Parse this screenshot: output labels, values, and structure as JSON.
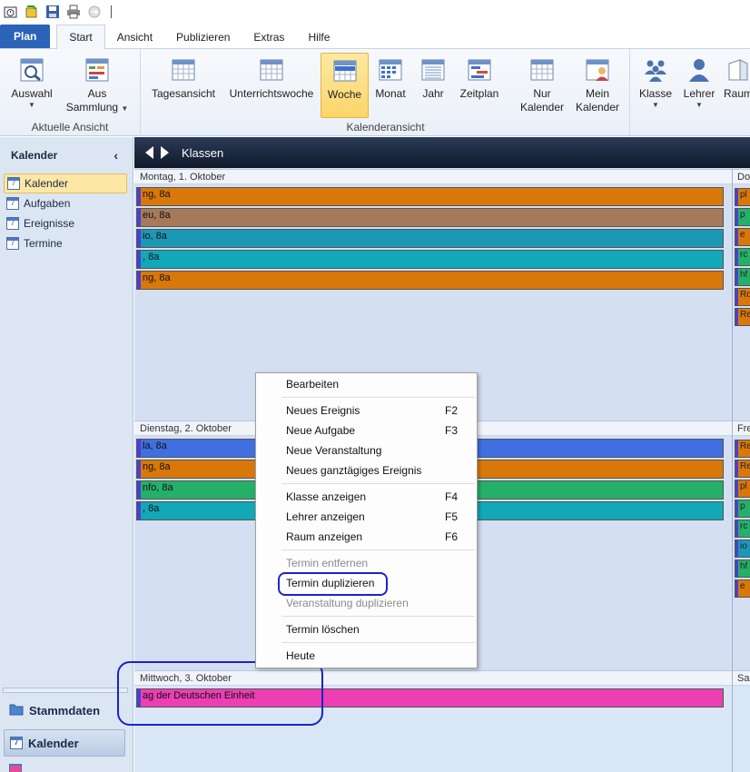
{
  "ribbon_tabs": {
    "plan": "Plan",
    "start": "Start",
    "ansicht": "Ansicht",
    "publizieren": "Publizieren",
    "extras": "Extras",
    "hilfe": "Hilfe"
  },
  "ribbon": {
    "group_aktuelle_ansicht": "Aktuelle Ansicht",
    "group_kalenderansicht": "Kalenderansicht",
    "auswahl": "Auswahl",
    "aus_sammlung_1": "Aus",
    "aus_sammlung_2": "Sammlung",
    "tagesansicht": "Tagesansicht",
    "unterrichtswoche": "Unterrichtswoche",
    "woche": "Woche",
    "monat": "Monat",
    "jahr": "Jahr",
    "zeitplan": "Zeitplan",
    "nur_kalender_1": "Nur",
    "nur_kalender_2": "Kalender",
    "mein_kalender_1": "Mein",
    "mein_kalender_2": "Kalender",
    "klasse": "Klasse",
    "lehrer": "Lehrer",
    "raum": "Raum"
  },
  "nav": {
    "title": "Kalender",
    "items": [
      "Kalender",
      "Aufgaben",
      "Ereignisse",
      "Termine"
    ],
    "stammdaten": "Stammdaten",
    "kalender": "Kalender"
  },
  "main": {
    "title": "Klassen",
    "days": [
      {
        "label": "Montag, 1. Oktober",
        "events": [
          "ng, 8a",
          "eu, 8a",
          "io, 8a",
          ", 8a",
          "ng, 8a"
        ]
      },
      {
        "label": "Dienstag, 2. Oktober",
        "events": [
          "la, 8a",
          "ng, 8a",
          "nfo, 8a",
          ", 8a"
        ]
      },
      {
        "label": "Mittwoch, 3. Oktober",
        "events": [
          "ag der Deutschen Einheit"
        ]
      }
    ],
    "right_days": [
      {
        "label": "Do",
        "events": [
          "pl",
          "p",
          "e",
          "rc",
          "hf",
          "Ro",
          "Re"
        ]
      },
      {
        "label": "Fre",
        "events": [
          "Re",
          "Re",
          "pl",
          "p",
          "rc",
          "io",
          "hf",
          "e"
        ]
      },
      {
        "label": "Sa",
        "events": []
      }
    ]
  },
  "context_menu": {
    "bearbeiten": "Bearbeiten",
    "neues_ereignis": "Neues Ereignis",
    "neues_ereignis_sc": "F2",
    "neue_aufgabe": "Neue Aufgabe",
    "neue_aufgabe_sc": "F3",
    "neue_veranstaltung": "Neue Veranstaltung",
    "neues_ganztaegiges": "Neues ganztägiges Ereignis",
    "klasse_anzeigen": "Klasse anzeigen",
    "klasse_anzeigen_sc": "F4",
    "lehrer_anzeigen": "Lehrer anzeigen",
    "lehrer_anzeigen_sc": "F5",
    "raum_anzeigen": "Raum anzeigen",
    "raum_anzeigen_sc": "F6",
    "termin_entfernen": "Termin entfernen",
    "termin_duplizieren": "Termin duplizieren",
    "veranstaltung_duplizieren": "Veranstaltung duplizieren",
    "termin_loeschen": "Termin löschen",
    "heute": "Heute"
  },
  "colors": {
    "orange": "#d8780a",
    "brown": "#a57a5a",
    "teal": "#1c98b7",
    "cyan": "#12a8b8",
    "blue": "#3f6fe0",
    "green": "#25b06a",
    "magenta": "#ec3fb3",
    "highlight": "#1a24c8"
  }
}
